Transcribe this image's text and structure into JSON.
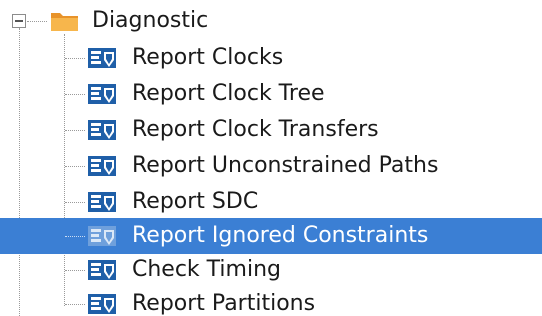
{
  "tree": {
    "folder": {
      "label": "Diagnostic",
      "expanded": true,
      "icon": "folder-icon"
    },
    "items": [
      {
        "label": "Report Clocks",
        "icon": "report-icon",
        "selected": false
      },
      {
        "label": "Report Clock Tree",
        "icon": "report-icon",
        "selected": false
      },
      {
        "label": "Report Clock Transfers",
        "icon": "report-icon",
        "selected": false
      },
      {
        "label": "Report Unconstrained Paths",
        "icon": "report-icon",
        "selected": false
      },
      {
        "label": "Report SDC",
        "icon": "report-icon",
        "selected": false
      },
      {
        "label": "Report Ignored Constraints",
        "icon": "report-icon",
        "selected": true
      },
      {
        "label": "Check Timing",
        "icon": "report-icon",
        "selected": false
      },
      {
        "label": "Report Partitions",
        "icon": "report-icon",
        "selected": false
      }
    ]
  },
  "colors": {
    "selection": "#3b7fd4",
    "text": "#1a1a1a",
    "folder": "#f2a53a",
    "icon_blue": "#1f5fa8"
  }
}
